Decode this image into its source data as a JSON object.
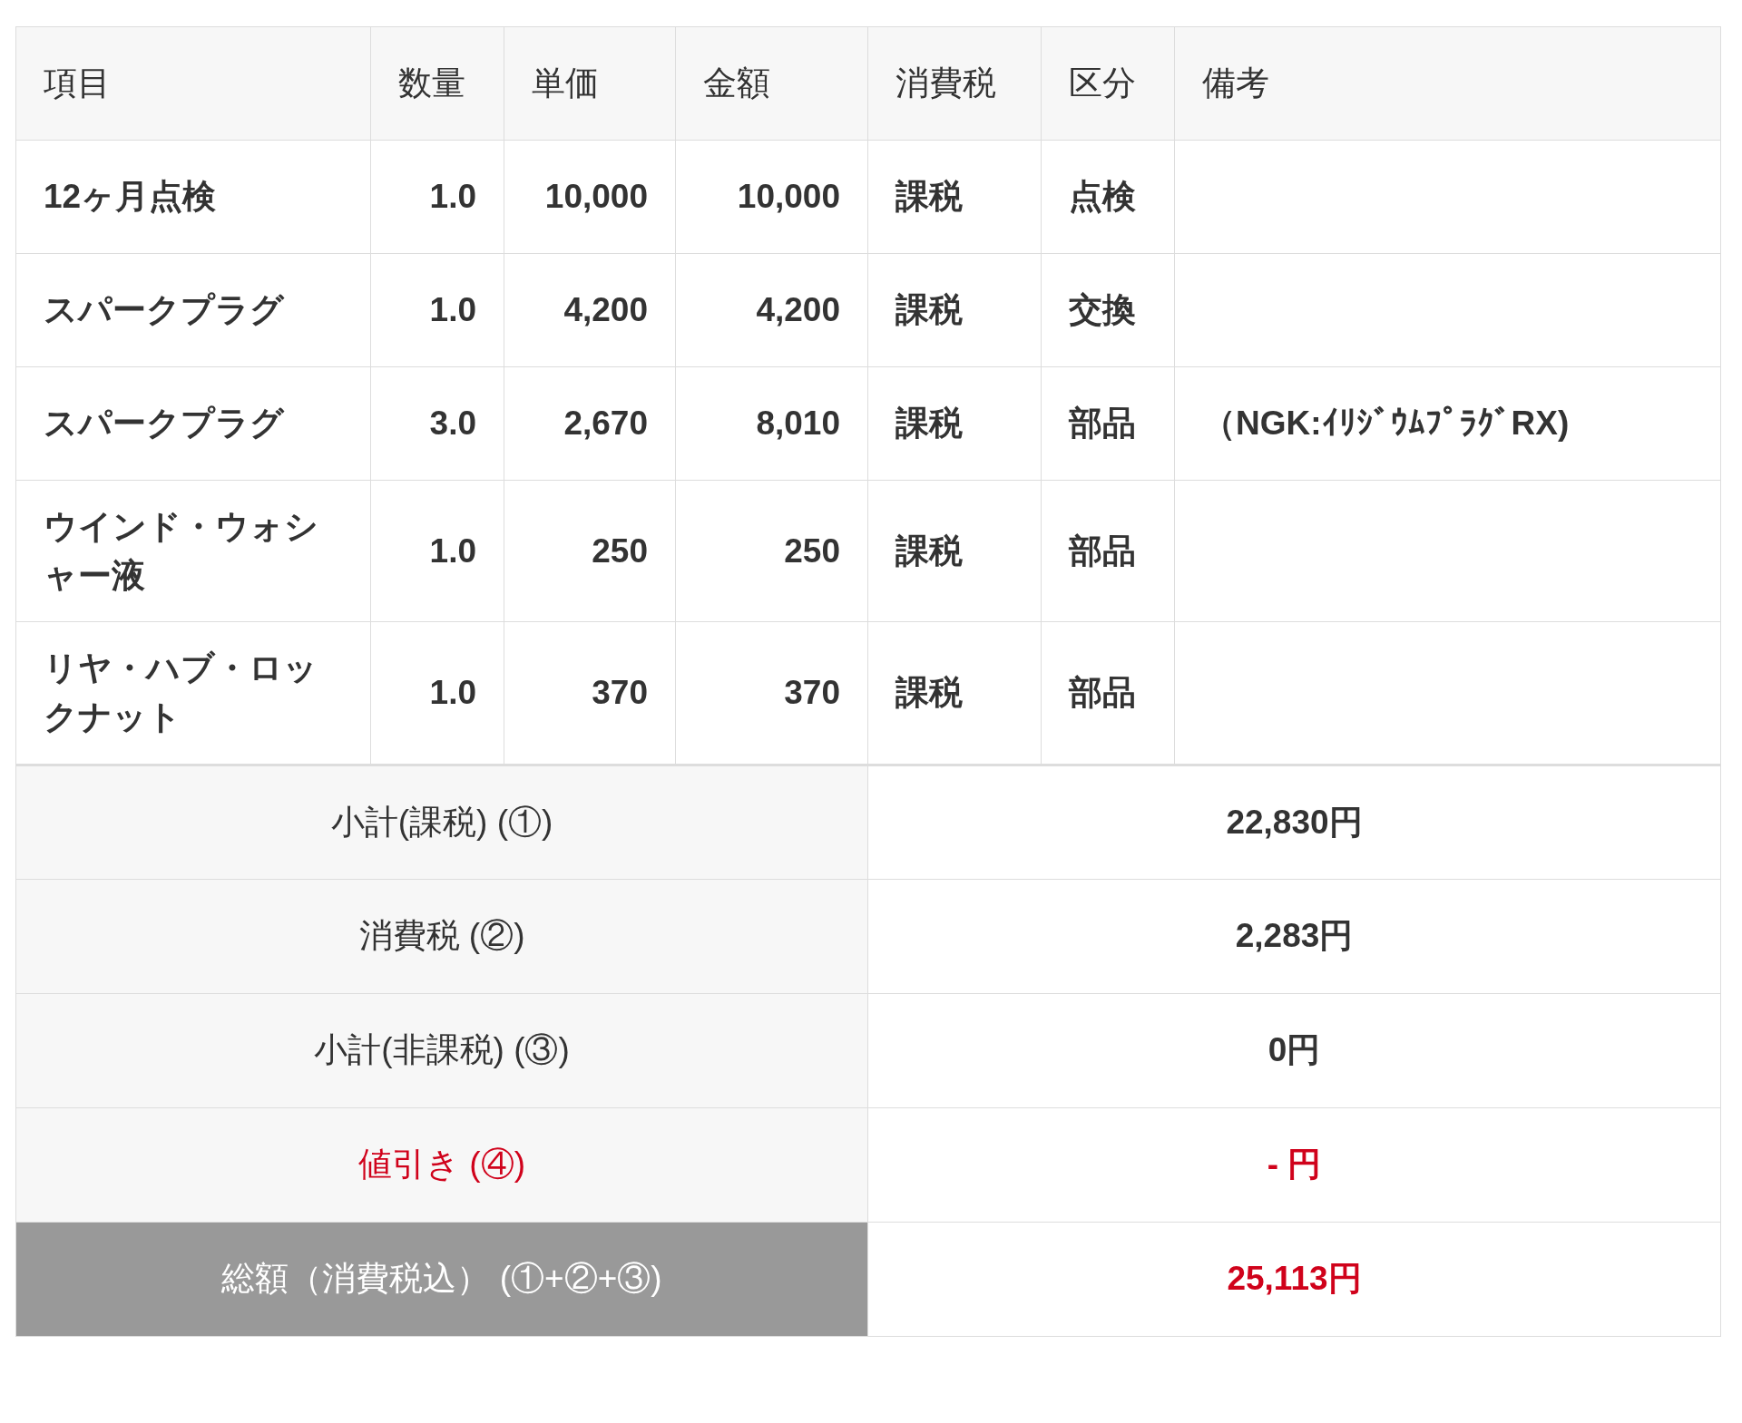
{
  "table": {
    "columns": [
      "項目",
      "数量",
      "単価",
      "金額",
      "消費税",
      "区分",
      "備考"
    ],
    "rows": [
      {
        "item": "12ヶ月点検",
        "quantity": "1.0",
        "unit_price": "10,000",
        "amount": "10,000",
        "tax": "課税",
        "category": "点検",
        "remarks": ""
      },
      {
        "item": "スパークプラグ",
        "quantity": "1.0",
        "unit_price": "4,200",
        "amount": "4,200",
        "tax": "課税",
        "category": "交換",
        "remarks": ""
      },
      {
        "item": "スパークプラグ",
        "quantity": "3.0",
        "unit_price": "2,670",
        "amount": "8,010",
        "tax": "課税",
        "category": "部品",
        "remarks": "（NGK:ｲﾘｼﾞｳﾑﾌﾟﾗｸﾞRX)"
      },
      {
        "item": "ウインド・ウォシャー液",
        "quantity": "1.0",
        "unit_price": "250",
        "amount": "250",
        "tax": "課税",
        "category": "部品",
        "remarks": ""
      },
      {
        "item": "リヤ・ハブ・ロックナット",
        "quantity": "1.0",
        "unit_price": "370",
        "amount": "370",
        "tax": "課税",
        "category": "部品",
        "remarks": ""
      }
    ]
  },
  "summary": [
    {
      "kind": "normal",
      "label": "小計(課税) (①)",
      "value": "22,830円"
    },
    {
      "kind": "normal",
      "label": "消費税 (②)",
      "value": "2,283円"
    },
    {
      "kind": "normal",
      "label": "小計(非課税) (③)",
      "value": "0円"
    },
    {
      "kind": "discount",
      "label": "値引き (④)",
      "value": "- 円"
    },
    {
      "kind": "total",
      "label": "総額（消費税込） (①+②+③)",
      "value": "25,113円"
    }
  ]
}
